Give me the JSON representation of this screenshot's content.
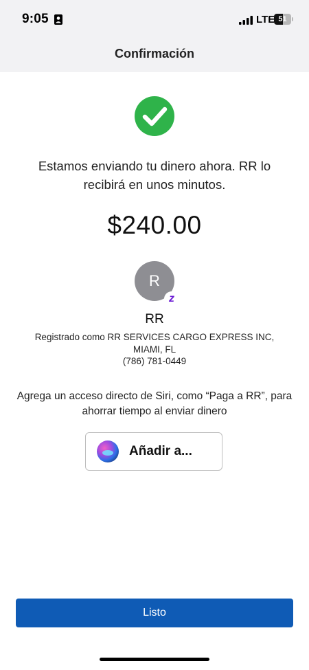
{
  "status_bar": {
    "time": "9:05",
    "network": "LTE",
    "battery_level": "51",
    "battery_fraction": 0.51
  },
  "nav": {
    "title": "Confirmación"
  },
  "confirmation": {
    "message": "Estamos enviando tu dinero ahora. RR lo recibirá en unos minutos.",
    "amount": "$240.00"
  },
  "recipient": {
    "initial": "R",
    "badge_letter": "z",
    "name": "RR",
    "registered_as": "Registrado como RR SERVICES CARGO EXPRESS INC, MIAMI, FL",
    "phone": "(786) 781-0449"
  },
  "siri": {
    "prompt": "Agrega un acceso directo de Siri, como “Paga a RR”, para ahorrar tiempo al enviar dinero",
    "button_label": "Añadir a..."
  },
  "actions": {
    "done_label": "Listo"
  },
  "icons": {
    "success": "checkmark-circle-icon",
    "status_contact": "contact-card-icon",
    "signal": "cellular-signal-icon",
    "battery": "battery-icon",
    "siri": "siri-icon",
    "zelle": "zelle-badge-icon"
  },
  "colors": {
    "success_green": "#2fb34a",
    "primary_blue": "#0f5bb5",
    "avatar_gray": "#8e8e93",
    "zelle_purple": "#6d1ed4",
    "header_background": "#f2f2f4"
  }
}
